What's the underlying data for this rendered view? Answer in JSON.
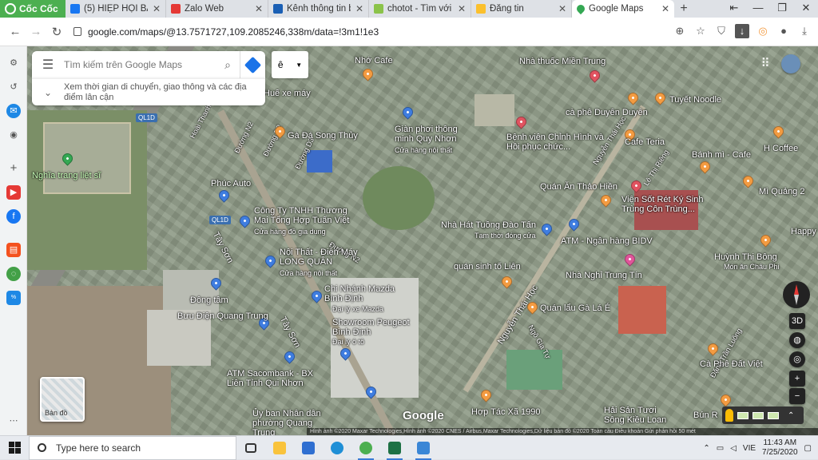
{
  "browser": {
    "brand": "Cốc Cốc",
    "tabs": [
      {
        "title": "(5) HIỆP HỘI BẤT Đ",
        "color": "#1877f2"
      },
      {
        "title": "Zalo Web",
        "color": "#e53935"
      },
      {
        "title": "Kênh thông tin bấ",
        "color": "#1a5fb4"
      },
      {
        "title": "chotot - Tìm với G",
        "color": "#8bc34a"
      },
      {
        "title": "Đăng tin",
        "color": "#fbc02d"
      },
      {
        "title": "Google Maps",
        "color": "#34a853",
        "active": true
      }
    ],
    "url": "google.com/maps/@13.7571727,109.2085246,338m/data=!3m1!1e3"
  },
  "maps": {
    "search_placeholder": "Tìm kiếm trên Google Maps",
    "commute_text": "Xem thời gian di chuyển, giao thông và các địa điểm lân cận",
    "lang_label": "ê",
    "layer_label": "Bản đồ",
    "view3d_label": "3D",
    "google_logo": "Google",
    "attribution": "Hình ảnh ©2020 Maxar Technologies,Hình ảnh ©2020 CNES / Airbus,Maxar Technologies,Dữ liệu bản đồ ©2020   Toàn cầu   Điều khoản   Gửi phản hồi   50 mét",
    "places": [
      {
        "name": "Nhớ Cafe",
        "pin": "o"
      },
      {
        "name": "Nhà thuốc Miền Trung",
        "pin": "r"
      },
      {
        "name": "Huế xe máy",
        "pin": "o"
      },
      {
        "name": "Gà Đá Song Thủy",
        "pin": "o"
      },
      {
        "name": "Giàn phơi thông minh Quy Nhơn",
        "sub": "Cửa hàng nội thất",
        "pin": "b"
      },
      {
        "name": "Bệnh viện Chỉnh Hình và Hồi phục chức...",
        "pin": "r"
      },
      {
        "name": "cà phê Duyên Duyên",
        "pin": "o"
      },
      {
        "name": "Tuyết Noodle",
        "pin": "o"
      },
      {
        "name": "Cafe Teria",
        "pin": "o"
      },
      {
        "name": "Bánh mì - Cafe",
        "pin": "o"
      },
      {
        "name": "H Coffee",
        "pin": "o"
      },
      {
        "name": "Nghĩa trang liệt sĩ",
        "pin": "g"
      },
      {
        "name": "Phúc Auto",
        "pin": "b"
      },
      {
        "name": "Công Ty TNHH Thương Mại Tổng Hợp Tuấn Việt",
        "sub": "Cửa hàng đồ gia dụng",
        "pin": "b"
      },
      {
        "name": "Quán Ăn Thảo Hiền",
        "pin": "o"
      },
      {
        "name": "Viện Sốt Rét Ký Sinh Trùng Côn Trùng...",
        "pin": "r"
      },
      {
        "name": "Mì Quảng 2",
        "pin": "o"
      },
      {
        "name": "Nhà Hát Tuồng Đào Tấn",
        "sub": "Tạm thời đóng cửa",
        "pin": "b"
      },
      {
        "name": "ATM - Ngân hàng BIDV",
        "pin": "b"
      },
      {
        "name": "Happy",
        "pin": "o"
      },
      {
        "name": "Nội Thất - Điện Máy LONG QUÂN",
        "sub": "Cửa hàng nội thất",
        "pin": "b"
      },
      {
        "name": "quán sinh tố Liên",
        "pin": "o"
      },
      {
        "name": "Huỳnh Thị Bông",
        "sub": "Món ăn Châu Phi",
        "pin": "o"
      },
      {
        "name": "Nhà Nghỉ Trung Tín",
        "pin": "m"
      },
      {
        "name": "Chi Nhánh Mazda Bình Định",
        "sub": "Đại lý xe Mazda",
        "pin": "b"
      },
      {
        "name": "Đông tâm",
        "pin": "b"
      },
      {
        "name": "Quán lẩu Gà Lá É",
        "pin": "o"
      },
      {
        "name": "Bưu Điện Quang Trung",
        "pin": "b"
      },
      {
        "name": "Showroom Peugeot Bình Định",
        "sub": "Đại lý ô tô",
        "pin": "b"
      },
      {
        "name": "Cà Phê Đất Việt",
        "pin": "o"
      },
      {
        "name": "ATM Sacombank - BX Liên Tỉnh Qui Nhơn",
        "pin": "b"
      },
      {
        "name": "Hợp Tác Xã 1990",
        "pin": "o"
      },
      {
        "name": "Hải Sản Tươi Sông Kiều Loan",
        "pin": "o"
      },
      {
        "name": "Ủy ban Nhân dân phường Quang Trung",
        "pin": "b"
      },
      {
        "name": "Bún R",
        "pin": "o"
      }
    ],
    "roads": [
      "QL1D",
      "QL1D",
      "Hoài Thanh",
      "Đường N2",
      "Đường D3",
      "Đường D2",
      "Tây Sơn",
      "Tây Sơn",
      "Đường N2",
      "Nguyễn Thái Học",
      "Ngô Gia Tự",
      "Nguyễn Thái Học",
      "Lê Thị Riêng",
      "Đặng Trần Luông"
    ]
  },
  "taskbar": {
    "search_placeholder": "Type here to search",
    "lang": "VIE",
    "time": "11:43 AM",
    "date": "7/25/2020"
  }
}
